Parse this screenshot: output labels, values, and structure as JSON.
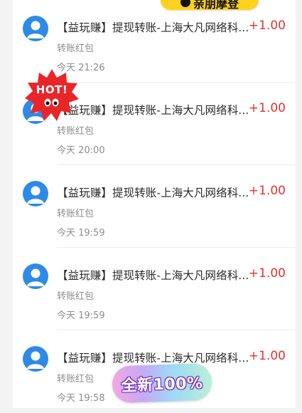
{
  "banner": {
    "text": "亲朋摩登"
  },
  "badges": {
    "hot": "HOT!",
    "new": "全新100%"
  },
  "transactions": [
    {
      "title": "【益玩赚】提现转账-上海大凡网络科...",
      "amount": "+1.00",
      "subtitle": "转账红包",
      "time": "今天 21:26"
    },
    {
      "title": "【益玩赚】提现转账-上海大凡网络科...",
      "amount": "+1.00",
      "subtitle": "转账红包",
      "time": "今天 20:00"
    },
    {
      "title": "【益玩赚】提现转账-上海大凡网络科...",
      "amount": "+1.00",
      "subtitle": "转账红包",
      "time": "今天 19:59"
    },
    {
      "title": "【益玩赚】提现转账-上海大凡网络科...",
      "amount": "+1.00",
      "subtitle": "转账红包",
      "time": "今天 19:59"
    },
    {
      "title": "【益玩赚】提现转账-上海大凡网络科...",
      "amount": "+1.00",
      "subtitle": "转账红包",
      "time": "今天 19:58"
    }
  ],
  "colors": {
    "avatar": "#2f8ae6",
    "amount": "#e5322d",
    "hot": "#e8262a"
  },
  "icons": {
    "avatar": "user-avatar-icon",
    "hot": "hot-starburst-icon"
  }
}
